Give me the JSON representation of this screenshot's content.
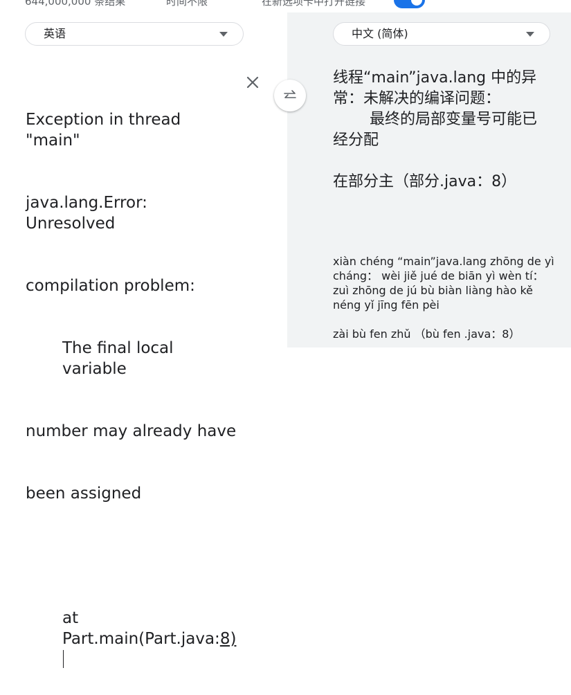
{
  "topbar": {
    "results_count": "644,000,000 条结果",
    "time_filter": "时间不限",
    "open_new_tab_label": "在新选项卡中打开链接",
    "open_new_tab_enabled": true
  },
  "source": {
    "language": "英语",
    "lines": [
      "Exception in thread \"main\"",
      "java.lang.Error: Unresolved",
      "compilation problem:",
      "The final local variable",
      "number may already have",
      "been assigned",
      "",
      "at Part.main(Part.java:"
    ],
    "link_text": "8)"
  },
  "target": {
    "language": "中文 (简体)",
    "lines": [
      "线程“main”java.lang 中的异",
      "常：未解决的编译问题：",
      "最终的局部变量号可能已",
      "经分配",
      "",
      "在部分主（部分.java：8）"
    ],
    "romanization": [
      "xiàn chéng “main”java.lang zhōng de yì",
      "cháng： wèi jiě jué de biān yì wèn tí：",
      "zuì zhōng de jú bù biàn liàng hào kě",
      "néng yǐ jīng fēn pèi",
      "",
      "zài bù fen zhǔ （bù fen .java：8）"
    ]
  },
  "icons": {
    "close": "close-icon",
    "swap": "swap-languages-icon",
    "dropdown": "chevron-down-icon"
  },
  "colors": {
    "accent": "#1a73e8",
    "target_panel_bg": "#f1f3f4"
  }
}
